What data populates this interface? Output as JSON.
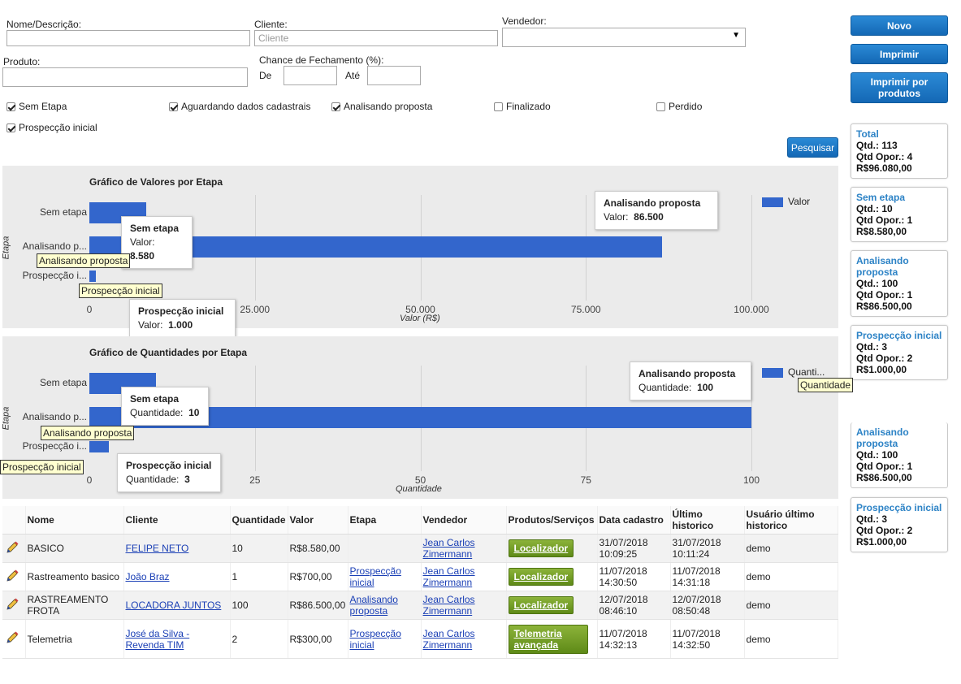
{
  "filters": {
    "nome_label": "Nome/Descrição:",
    "nome_value": "",
    "cliente_label": "Cliente:",
    "cliente_placeholder": "Cliente",
    "vendedor_label": "Vendedor:",
    "vendedor_value": "",
    "produto_label": "Produto:",
    "produto_value": "",
    "chance_label": "Chance de Fechamento (%):",
    "de_label": "De",
    "ate_label": "Até",
    "etapas": [
      {
        "label": "Sem Etapa",
        "checked": true
      },
      {
        "label": "Aguardando dados cadastrais",
        "checked": true
      },
      {
        "label": "Analisando proposta",
        "checked": true
      },
      {
        "label": "Finalizado",
        "checked": false
      },
      {
        "label": "Perdido",
        "checked": false
      },
      {
        "label": "Prospecção inicial",
        "checked": true
      }
    ],
    "search_button": "Pesquisar"
  },
  "actions": {
    "novo": "Novo",
    "imprimir": "Imprimir",
    "imprimir_produtos": "Imprimir por produtos"
  },
  "summary": [
    {
      "title": "Total",
      "qtd": "Qtd.: 113",
      "opor": "Qtd Opor.: 4",
      "valor": "R$96.080,00"
    },
    {
      "title": "Sem etapa",
      "qtd": "Qtd.: 10",
      "opor": "Qtd Opor.: 1",
      "valor": "R$8.580,00"
    },
    {
      "title": "Analisando proposta",
      "qtd": "Qtd.: 100",
      "opor": "Qtd Opor.: 1",
      "valor": "R$86.500,00"
    },
    {
      "title": "Prospecção inicial",
      "qtd": "Qtd.: 3",
      "opor": "Qtd Opor.: 2",
      "valor": "R$1.000,00"
    },
    {
      "title": "Analisando proposta",
      "qtd": "Qtd.: 100",
      "opor": "Qtd Opor.: 1",
      "valor": "R$86.500,00"
    },
    {
      "title": "Prospecção inicial",
      "qtd": "Qtd.: 3",
      "opor": "Qtd Opor.: 2",
      "valor": "R$1.000,00"
    }
  ],
  "chart_data": [
    {
      "type": "bar",
      "title": "Gráfico de Valores por Etapa",
      "categories": [
        "Sem etapa",
        "Analisando p...",
        "Prospecção i..."
      ],
      "full_categories": [
        "Sem etapa",
        "Analisando proposta",
        "Prospecção inicial"
      ],
      "series": [
        {
          "name": "Valor",
          "values": [
            8580,
            86500,
            1000
          ]
        }
      ],
      "value_labels": [
        "8.580",
        "86.500",
        "1.000"
      ],
      "xlabel": "Valor (R$)",
      "ylabel": "Etapa",
      "xlim": [
        0,
        100000
      ],
      "ticks": [
        0,
        25000,
        50000,
        75000,
        100000
      ],
      "tick_labels": [
        "0",
        "25.000",
        "50.000",
        "75.000",
        "100.000"
      ],
      "legend_label": "Valor",
      "tooltip_metric": "Valor:",
      "legend_position": "right",
      "color": "#3366cc"
    },
    {
      "type": "bar",
      "title": "Gráfico de Quantidades por Etapa",
      "categories": [
        "Sem etapa",
        "Analisando p...",
        "Prospecção i..."
      ],
      "full_categories": [
        "Sem etapa",
        "Analisando proposta",
        "Prospecção inicial"
      ],
      "series": [
        {
          "name": "Quantidade",
          "values": [
            10,
            100,
            3
          ]
        }
      ],
      "value_labels": [
        "10",
        "100",
        "3"
      ],
      "xlabel": "Quantidade",
      "ylabel": "Etapa",
      "xlim": [
        0,
        100
      ],
      "ticks": [
        0,
        25,
        50,
        75,
        100
      ],
      "tick_labels": [
        "0",
        "25",
        "50",
        "75",
        "100"
      ],
      "legend_label": "Quanti...",
      "legend_tooltip": "Quantidade",
      "tooltip_metric": "Quantidade:",
      "legend_position": "right",
      "color": "#3366cc"
    }
  ],
  "table": {
    "headers": [
      "",
      "Nome",
      "Cliente",
      "Quantidade",
      "Valor",
      "Etapa",
      "Vendedor",
      "Produtos/Serviços",
      "Data cadastro",
      "Último historico",
      "Usuário último historico"
    ],
    "rows": [
      {
        "nome": "BASICO",
        "cliente": "FELIPE NETO",
        "quantidade": "10",
        "valor": "R$8.580,00",
        "etapa": "",
        "vendedor": "Jean Carlos Zimermann",
        "produto": "Localizador",
        "data_cadastro": "31/07/2018 10:09:25",
        "ultimo": "31/07/2018 10:11:24",
        "usuario": "demo"
      },
      {
        "nome": "Rastreamento basico",
        "cliente": "João Braz",
        "quantidade": "1",
        "valor": "R$700,00",
        "etapa": "Prospecção inicial",
        "vendedor": "Jean Carlos Zimermann",
        "produto": "Localizador",
        "data_cadastro": "11/07/2018 14:30:50",
        "ultimo": "11/07/2018 14:31:18",
        "usuario": "demo"
      },
      {
        "nome": "RASTREAMENTO FROTA",
        "cliente": "LOCADORA JUNTOS",
        "quantidade": "100",
        "valor": "R$86.500,00",
        "etapa": "Analisando proposta",
        "vendedor": "Jean Carlos Zimermann",
        "produto": "Localizador",
        "data_cadastro": "12/07/2018 08:46:10",
        "ultimo": "12/07/2018 08:50:48",
        "usuario": "demo"
      },
      {
        "nome": "Telemetria",
        "cliente": "José da Silva - Revenda TIM",
        "quantidade": "2",
        "valor": "R$300,00",
        "etapa": "Prospecção inicial",
        "vendedor": "Jean Carlos Zimermann",
        "produto": "Telemetria avançada",
        "data_cadastro": "11/07/2018 14:32:13",
        "ultimo": "11/07/2018 14:32:50",
        "usuario": "demo"
      }
    ]
  }
}
